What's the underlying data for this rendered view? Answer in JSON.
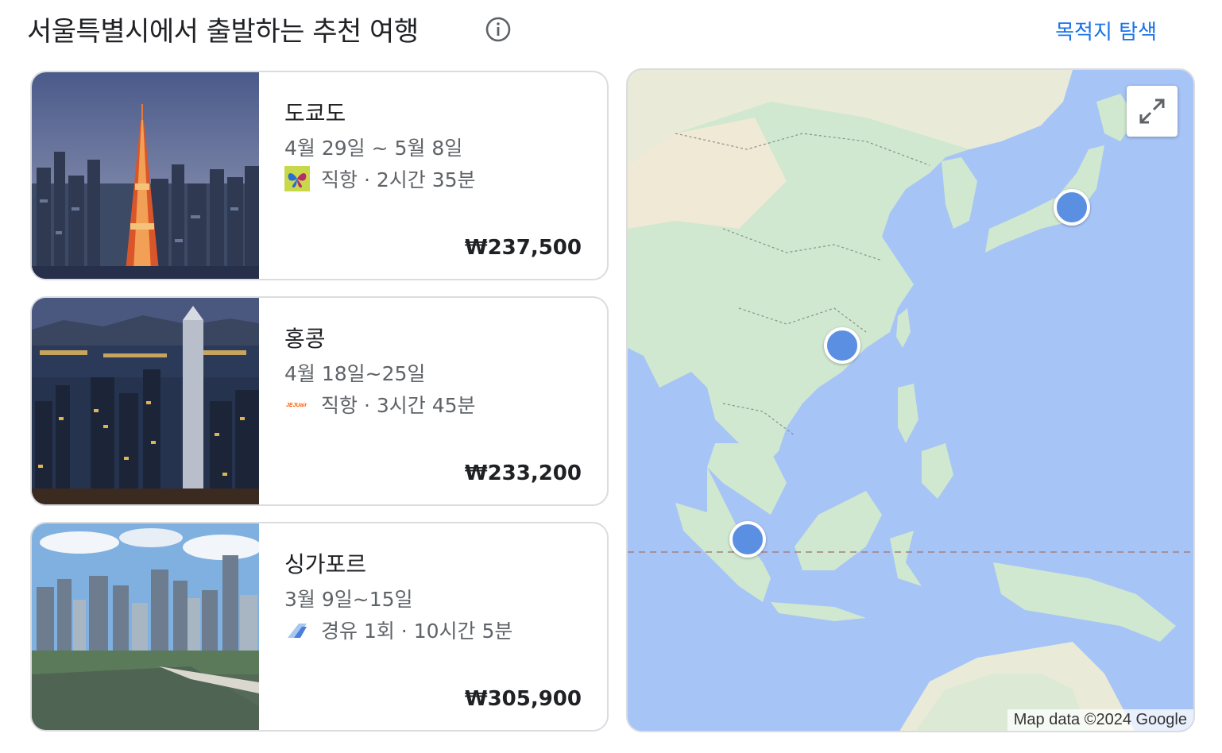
{
  "header": {
    "title": "서울특별시에서 출발하는 추천 여행",
    "explore_label": "목적지 탐색"
  },
  "cards": [
    {
      "destination": "도쿄도",
      "dates": "4월 29일 ~ 5월 8일",
      "flight_info": "직항 · 2시간 35분",
      "price": "₩237,500",
      "airline_logo": "butterfly-airline-logo"
    },
    {
      "destination": "홍콩",
      "dates": "4월 18일~25일",
      "flight_info": "직항 · 3시간 45분",
      "price": "₩233,200",
      "airline_logo": "jejuair-logo",
      "airline_logo_text": "JEJUair"
    },
    {
      "destination": "싱가포르",
      "dates": "3월 9일~15일",
      "flight_info": "경유 1회 · 10시간 5분",
      "price": "₩305,900",
      "airline_logo": "tail-airline-logo"
    }
  ],
  "map": {
    "attribution": "Map data ©2024 Google",
    "colors": {
      "water": "#a7c4f6",
      "land": "#cfe8cf",
      "marker": "#5b8fe2"
    }
  }
}
